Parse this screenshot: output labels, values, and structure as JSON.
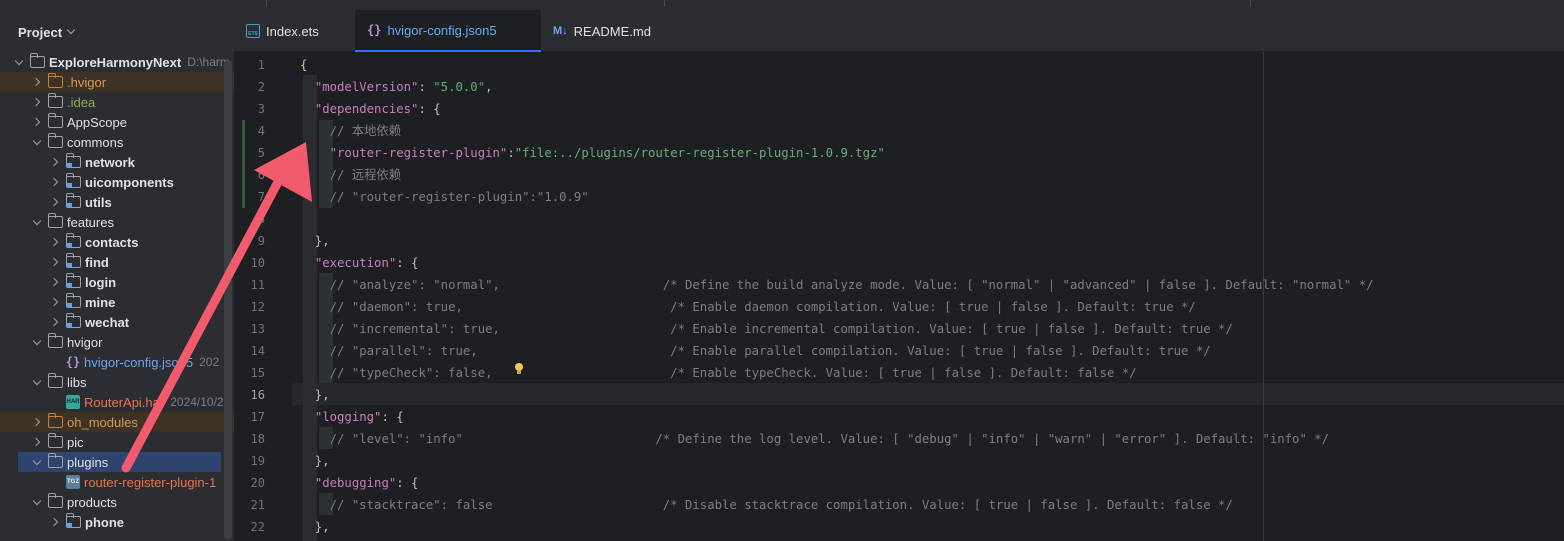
{
  "sidebar": {
    "title": "Project",
    "tree": [
      {
        "label": "ExploreHarmonyNext",
        "sub": "D:\\harm",
        "depth": 0,
        "arrow": "open",
        "icon": "folder",
        "style": "bold"
      },
      {
        "label": ".hvigor",
        "depth": 1,
        "arrow": "closed",
        "icon": "folder-orange",
        "style": "orange",
        "hl": "excluded"
      },
      {
        "label": ".idea",
        "depth": 1,
        "arrow": "closed",
        "icon": "folder",
        "style": "green"
      },
      {
        "label": "AppScope",
        "depth": 1,
        "arrow": "closed",
        "icon": "folder"
      },
      {
        "label": "commons",
        "depth": 1,
        "arrow": "open",
        "icon": "folder"
      },
      {
        "label": "network",
        "depth": 2,
        "arrow": "closed",
        "icon": "module",
        "style": "bold"
      },
      {
        "label": "uicomponents",
        "depth": 2,
        "arrow": "closed",
        "icon": "module",
        "style": "bold"
      },
      {
        "label": "utils",
        "depth": 2,
        "arrow": "closed",
        "icon": "module",
        "style": "bold"
      },
      {
        "label": "features",
        "depth": 1,
        "arrow": "open",
        "icon": "folder"
      },
      {
        "label": "contacts",
        "depth": 2,
        "arrow": "closed",
        "icon": "module",
        "style": "bold"
      },
      {
        "label": "find",
        "depth": 2,
        "arrow": "closed",
        "icon": "module",
        "style": "bold"
      },
      {
        "label": "login",
        "depth": 2,
        "arrow": "closed",
        "icon": "module",
        "style": "bold"
      },
      {
        "label": "mine",
        "depth": 2,
        "arrow": "closed",
        "icon": "module",
        "style": "bold"
      },
      {
        "label": "wechat",
        "depth": 2,
        "arrow": "closed",
        "icon": "module",
        "style": "bold"
      },
      {
        "label": "hvigor",
        "depth": 1,
        "arrow": "open",
        "icon": "folder"
      },
      {
        "label": "hvigor-config.json5",
        "sub": "202",
        "depth": 2,
        "arrow": "none",
        "icon": "json",
        "style": "blue"
      },
      {
        "label": "libs",
        "depth": 1,
        "arrow": "open",
        "icon": "folder"
      },
      {
        "label": "RouterApi.har",
        "sub": "2024/10/2",
        "depth": 2,
        "arrow": "none",
        "icon": "har",
        "style": "red"
      },
      {
        "label": "oh_modules",
        "depth": 1,
        "arrow": "closed",
        "icon": "folder-orange",
        "style": "orange",
        "hl": "excluded"
      },
      {
        "label": "pic",
        "depth": 1,
        "arrow": "closed",
        "icon": "folder"
      },
      {
        "label": "plugins",
        "depth": 1,
        "arrow": "open",
        "icon": "folder",
        "hl": "selected"
      },
      {
        "label": "router-register-plugin-1",
        "depth": 2,
        "arrow": "none",
        "icon": "tgz",
        "style": "red"
      },
      {
        "label": "products",
        "depth": 1,
        "arrow": "open",
        "icon": "folder"
      },
      {
        "label": "phone",
        "depth": 2,
        "arrow": "closed",
        "icon": "module",
        "style": "bold"
      }
    ]
  },
  "tabs": [
    {
      "label": "Index.ets",
      "icon": "ets"
    },
    {
      "label": "hvigor-config.json5",
      "icon": "json",
      "active": true
    },
    {
      "label": "README.md",
      "icon": "md"
    }
  ],
  "tab_icons": {
    "ets": "ETS",
    "json": "{}",
    "md": "M↓"
  },
  "file_icons": {
    "har": "HAR",
    "tgz": "TGZ",
    "json": "{}"
  },
  "current_line": 16,
  "code": [
    [
      [
        "br",
        "{"
      ]
    ],
    [
      [
        "p",
        "  "
      ],
      [
        "k",
        "\"modelVersion\""
      ],
      [
        "p",
        ": "
      ],
      [
        "s",
        "\"5.0.0\""
      ],
      [
        "p",
        ","
      ]
    ],
    [
      [
        "p",
        "  "
      ],
      [
        "k",
        "\"dependencies\""
      ],
      [
        "p",
        ": {"
      ]
    ],
    [
      [
        "p",
        "    "
      ],
      [
        "c",
        "// 本地依赖"
      ]
    ],
    [
      [
        "p",
        "    "
      ],
      [
        "k",
        "\"router-register-plugin\""
      ],
      [
        "p",
        ":"
      ],
      [
        "s",
        "\"file:../plugins/router-register-plugin-1.0.9.tgz\""
      ]
    ],
    [
      [
        "p",
        "    "
      ],
      [
        "c",
        "// 远程依赖"
      ]
    ],
    [
      [
        "p",
        "    "
      ],
      [
        "c",
        "// \"router-register-plugin\":\"1.0.9\""
      ]
    ],
    [
      [
        "p",
        ""
      ]
    ],
    [
      [
        "p",
        "  },"
      ]
    ],
    [
      [
        "p",
        "  "
      ],
      [
        "k",
        "\"execution\""
      ],
      [
        "p",
        ": {"
      ]
    ],
    [
      [
        "p",
        "    "
      ],
      [
        "c",
        "// \"analyze\": \"normal\",                      /* Define the build analyze mode. Value: [ \"normal\" | \"advanced\" | false ]. Default: \"normal\" */"
      ]
    ],
    [
      [
        "p",
        "    "
      ],
      [
        "c",
        "// \"daemon\": true,                            /* Enable daemon compilation. Value: [ true | false ]. Default: true */"
      ]
    ],
    [
      [
        "p",
        "    "
      ],
      [
        "c",
        "// \"incremental\": true,                       /* Enable incremental compilation. Value: [ true | false ]. Default: true */"
      ]
    ],
    [
      [
        "p",
        "    "
      ],
      [
        "c",
        "// \"parallel\": true,                          /* Enable parallel compilation. Value: [ true | false ]. Default: true */"
      ]
    ],
    [
      [
        "p",
        "    "
      ],
      [
        "c",
        "// \"typeCheck\": false,                        /* Enable typeCheck. Value: [ true | false ]. Default: false */"
      ]
    ],
    [
      [
        "p",
        "  },"
      ]
    ],
    [
      [
        "p",
        "  "
      ],
      [
        "k",
        "\"logging\""
      ],
      [
        "p",
        ": {"
      ]
    ],
    [
      [
        "p",
        "    "
      ],
      [
        "c",
        "// \"level\": \"info\"                          /* Define the log level. Value: [ \"debug\" | \"info\" | \"warn\" | \"error\" ]. Default: \"info\" */"
      ]
    ],
    [
      [
        "p",
        "  },"
      ]
    ],
    [
      [
        "p",
        "  "
      ],
      [
        "k",
        "\"debugging\""
      ],
      [
        "p",
        ": {"
      ]
    ],
    [
      [
        "p",
        "    "
      ],
      [
        "c",
        "// \"stacktrace\": false                       /* Disable stacktrace compilation. Value: [ true | false ]. Default: false */"
      ]
    ],
    [
      [
        "p",
        "  },"
      ]
    ]
  ],
  "colors": {
    "accent": "#3574f0",
    "annotation_arrow": "#f25a6e",
    "json_key": "#c77dbb",
    "json_string": "#6aab73",
    "comment": "#7a7e85"
  }
}
